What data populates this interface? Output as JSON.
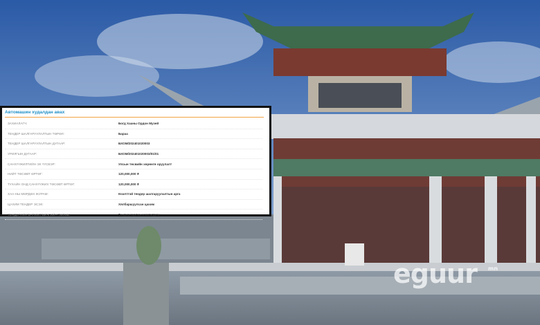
{
  "card": {
    "title": "Автомашин худалдан авах",
    "rows": [
      {
        "label": "ЗАХИАЛАГЧ:",
        "value": "Богд Хааны Ордон Музей"
      },
      {
        "label": "ТЕНДЕР ШАЛГАРУУЛАЛТЫН ТӨРӨЛ:",
        "value": "Бараа"
      },
      {
        "label": "ТЕНДЕР ШАЛГАРУУЛАЛТЫН ДУГААР:",
        "value": "БХОМ/202401020003"
      },
      {
        "label": "УРИЛГЫН ДУГААР:",
        "value": "БХОМ/202401020003/01/01"
      },
      {
        "label": "САНХҮҮЖИЛТИЙН ЭХ ҮҮСВЭР:",
        "value": "Улсын төсвийн хөрөнгө оруулалт"
      },
      {
        "label": "НИЙТ ТӨСӨВТ ӨРТӨГ:",
        "value": "120,000,000 ₮"
      },
      {
        "label": "ТУХАЙН ОНД САНХҮҮЖИХ ТӨСӨВТ ӨРТӨГ:",
        "value": "120,000,000 ₮"
      },
      {
        "label": "ХАА-НЫ МӨРДӨХ ЖУРАМ:",
        "value": "Нээлттэй тендер шалгаруулалтын арга"
      },
      {
        "label": "ЦАХИМ ТЕНДЕР ЭСЭХ:",
        "value": "Хялбаршуулсан цахим"
      },
      {
        "label": "ТЕНДЕРИЙН БАРИМТ БИЧГИЙН ТӨЛӨВ:",
        "value": "Тендер зарлаж хэвлэгдсэн"
      }
    ]
  },
  "watermark": {
    "text": "eguur",
    "suffix": "mn"
  },
  "colors": {
    "accent": "#1f8fc7",
    "rule": "#f2a444",
    "sky": "#6c91c4"
  }
}
